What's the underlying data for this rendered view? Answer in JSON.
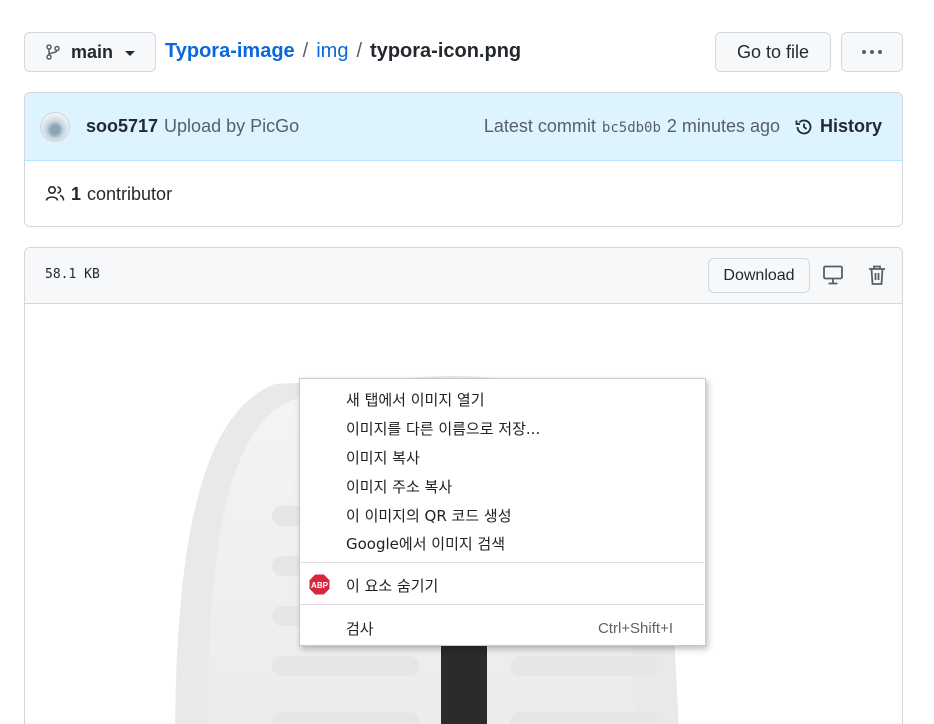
{
  "header": {
    "branch": "main",
    "breadcrumb": {
      "repo": "Typora-image",
      "sep": "/",
      "dir": "img",
      "file": "typora-icon.png"
    },
    "goto_file": "Go to file"
  },
  "commit": {
    "author": "soo5717",
    "message": "Upload by PicGo",
    "latest_label": "Latest commit",
    "sha": "bc5db0b",
    "time": "2 minutes ago",
    "history": "History"
  },
  "contributors": {
    "count": "1",
    "label": "contributor"
  },
  "file": {
    "size": "58.1 KB",
    "download": "Download"
  },
  "context_menu": {
    "items": [
      "새 탭에서 이미지 열기",
      "이미지를 다른 이름으로 저장...",
      "이미지 복사",
      "이미지 주소 복사",
      "이 이미지의 QR 코드 생성",
      "Google에서 이미지 검색"
    ],
    "adblock": {
      "badge": "ABP",
      "label": "이 요소 숨기기"
    },
    "inspect": {
      "label": "검사",
      "shortcut": "Ctrl+Shift+I"
    }
  },
  "colors": {
    "link": "#0969da",
    "commit_bg": "#ddf4ff",
    "abp_red": "#d7263d"
  }
}
